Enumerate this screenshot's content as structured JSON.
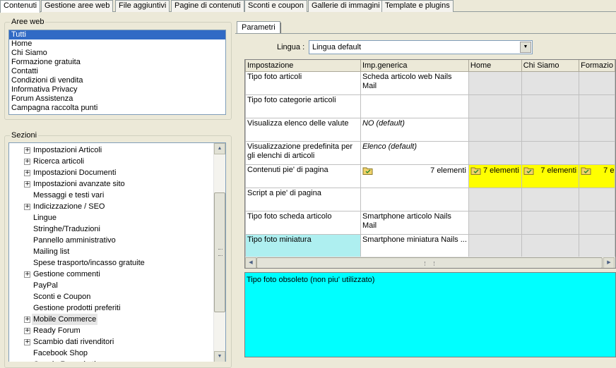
{
  "tabs": [
    "Contenuti",
    "Gestione aree web",
    "File aggiuntivi",
    "Pagine di contenuti",
    "Sconti e coupon",
    "Gallerie di immagini",
    "Template e plugins"
  ],
  "aree": {
    "title": "Aree web",
    "items": [
      "Tutti",
      "Home",
      "Chi Siamo",
      "Formazione gratuita",
      "Contatti",
      "Condizioni di vendita",
      "Informativa Privacy",
      "Forum Assistenza",
      "Campagna raccolta punti"
    ]
  },
  "sezioni": {
    "title": "Sezioni",
    "items": [
      {
        "label": "Impostazioni Articoli",
        "expand": "+"
      },
      {
        "label": "Ricerca articoli",
        "expand": "+"
      },
      {
        "label": "Impostazioni Documenti",
        "expand": "+"
      },
      {
        "label": "Impostazioni avanzate sito",
        "expand": "+"
      },
      {
        "label": "Messaggi e testi vari",
        "expand": ""
      },
      {
        "label": "Indicizzazione / SEO",
        "expand": "+"
      },
      {
        "label": "Lingue",
        "expand": ""
      },
      {
        "label": "Stringhe/Traduzioni",
        "expand": ""
      },
      {
        "label": "Pannello amministrativo",
        "expand": ""
      },
      {
        "label": "Mailing list",
        "expand": ""
      },
      {
        "label": "Spese trasporto/incasso gratuite",
        "expand": ""
      },
      {
        "label": "Gestione commenti",
        "expand": "+"
      },
      {
        "label": "PayPal",
        "expand": ""
      },
      {
        "label": "Sconti e Coupon",
        "expand": ""
      },
      {
        "label": "Gestione prodotti preferiti",
        "expand": ""
      },
      {
        "label": "Mobile Commerce",
        "expand": "+"
      },
      {
        "label": "Ready Forum",
        "expand": "+"
      },
      {
        "label": "Scambio dati rivenditori",
        "expand": "+"
      },
      {
        "label": "Facebook Shop",
        "expand": ""
      },
      {
        "label": "Google Remarketing",
        "expand": ""
      }
    ]
  },
  "parametri": {
    "tab_label": "Parametri",
    "lingua_label": "Lingua :",
    "lingua_value": "Lingua default",
    "columns": [
      "Impostazione",
      "Imp.generica",
      "Home",
      "Chi Siamo",
      "Formazio"
    ],
    "rows": [
      {
        "name": "Tipo foto articoli",
        "generica": "Scheda articolo web Nails Mail"
      },
      {
        "name": "Tipo foto categorie articoli",
        "generica": ""
      },
      {
        "name": "Visualizza elenco delle valute",
        "generica": "NO (default)"
      },
      {
        "name": "Visualizzazione predefinita per gli elenchi di articoli",
        "generica": "Elenco (default)"
      },
      {
        "name": "Contenuti pie' di pagina",
        "generica": "7 elementi",
        "home": "7 elementi",
        "chi_siamo": "7 elementi",
        "formazione": "7 e"
      },
      {
        "name": "Script a pie' di pagina",
        "generica": ""
      },
      {
        "name": "Tipo foto scheda articolo",
        "generica": "Smartphone articolo Nails Mail"
      },
      {
        "name": "Tipo foto miniatura",
        "generica": "Smartphone miniatura Nails ..."
      }
    ],
    "description": "Tipo foto obsoleto (non piu' utilizzato)"
  },
  "colors": {
    "selection": "#316ac5",
    "yellow": "#ffff00",
    "cyan": "#00ffff",
    "selected_cell": "#aeeff0"
  },
  "icons": [
    "folder-icon",
    "scroll-up-icon",
    "scroll-down-icon",
    "scroll-left-icon",
    "scroll-right-icon",
    "dropdown-arrow-icon",
    "expand-icon"
  ]
}
